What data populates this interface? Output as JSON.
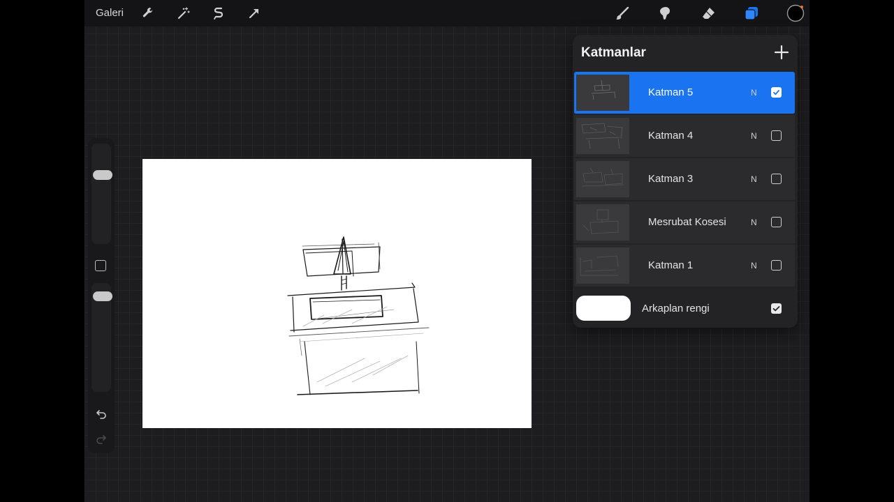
{
  "topbar": {
    "gallery_label": "Galeri",
    "left_icons": [
      "wrench-icon",
      "magic-wand-icon",
      "selection-icon",
      "transform-arrow-icon"
    ],
    "right_icons": [
      "brush-icon",
      "smudge-icon",
      "eraser-icon",
      "layers-icon",
      "color-swatch-icon"
    ]
  },
  "colors": {
    "accent": "#1a73f0",
    "canvas": "#ffffff",
    "panel": "#232325",
    "app_bg": "#1d1d1f",
    "current_color": "#000000"
  },
  "sidebar": {
    "brush_size_level": 0.9,
    "opacity_level": 0.9,
    "icons": [
      "modify-square-icon",
      "undo-icon",
      "redo-icon"
    ]
  },
  "layers": {
    "title": "Katmanlar",
    "items": [
      {
        "name": "Katman 5",
        "blend": "N",
        "visible": true,
        "active": true
      },
      {
        "name": "Katman 4",
        "blend": "N",
        "visible": false,
        "active": false
      },
      {
        "name": "Katman 3",
        "blend": "N",
        "visible": false,
        "active": false
      },
      {
        "name": "Mesrubat Kosesi",
        "blend": "N",
        "visible": false,
        "active": false
      },
      {
        "name": "Katman 1",
        "blend": "N",
        "visible": false,
        "active": false
      }
    ],
    "background": {
      "label": "Arkaplan rengi",
      "color": "#ffffff",
      "visible": true
    }
  }
}
